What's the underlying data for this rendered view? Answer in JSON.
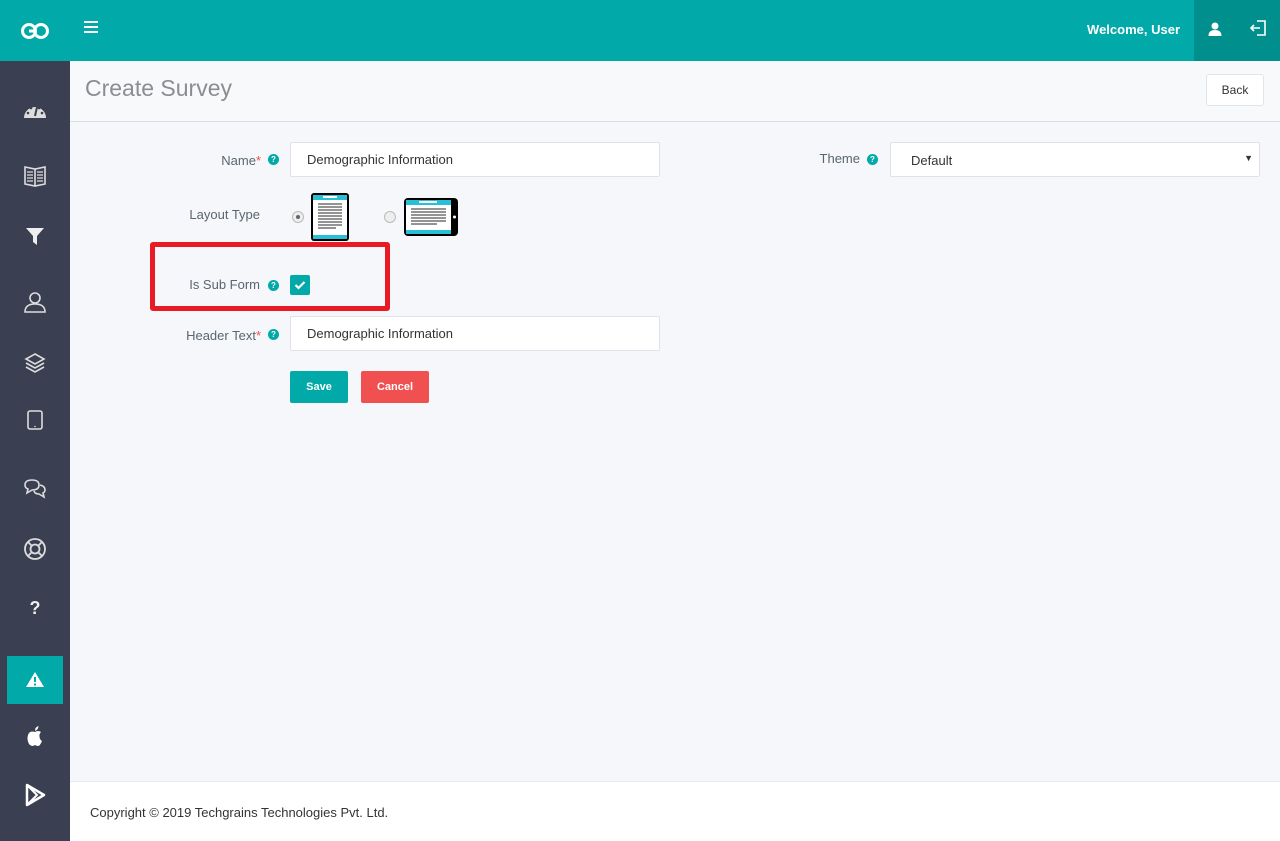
{
  "topbar": {
    "logo_text": "GO",
    "welcome_text": "Welcome, User",
    "brand_color": "#01a9a8"
  },
  "sidebar": {
    "items": [
      {
        "icon": "dashboard-icon",
        "active": false
      },
      {
        "icon": "book-icon",
        "active": false
      },
      {
        "icon": "filter-icon",
        "active": false
      },
      {
        "icon": "user-icon",
        "active": false
      },
      {
        "icon": "layers-icon",
        "active": false
      },
      {
        "icon": "tablet-icon",
        "active": false
      },
      {
        "icon": "chat-icon",
        "active": false
      },
      {
        "icon": "lifebuoy-icon",
        "active": false
      },
      {
        "icon": "question-icon",
        "active": false
      },
      {
        "icon": "warning-icon",
        "active": true
      },
      {
        "icon": "apple-icon",
        "active": false
      },
      {
        "icon": "play-store-icon",
        "active": false
      }
    ]
  },
  "page": {
    "title": "Create Survey",
    "back_label": "Back"
  },
  "form": {
    "name_label": "Name",
    "name_value": "Demographic Information",
    "required_mark": "*",
    "help_glyph": "?",
    "theme_label": "Theme",
    "theme_value": "Default",
    "layout_type_label": "Layout Type",
    "layout_options": [
      {
        "name": "portrait-tablet",
        "selected": true
      },
      {
        "name": "landscape-tablet",
        "selected": false
      }
    ],
    "is_sub_form_label": "Is Sub Form",
    "is_sub_form_checked": true,
    "header_text_label": "Header Text",
    "header_text_value": "Demographic Information",
    "save_label": "Save",
    "cancel_label": "Cancel"
  },
  "footer": {
    "copyright": "Copyright © 2019 Techgrains Technologies Pvt. Ltd."
  }
}
